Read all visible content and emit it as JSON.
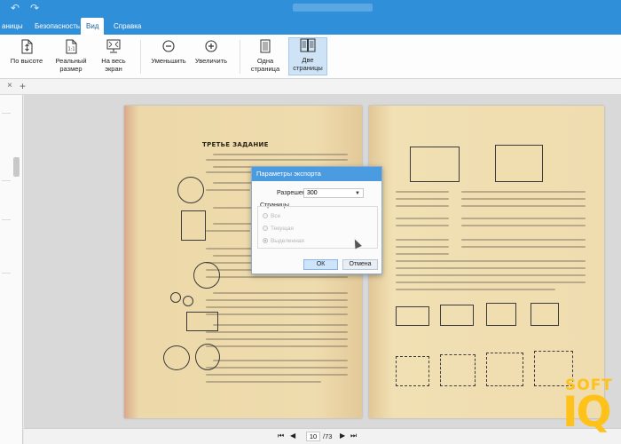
{
  "window": {
    "title": "",
    "undo_icon": "undo-icon",
    "redo_icon": "redo-icon"
  },
  "tabs": [
    {
      "label": "аницы"
    },
    {
      "label": "Безопасность"
    },
    {
      "label": "Вид"
    },
    {
      "label": "Справка"
    }
  ],
  "ribbon": {
    "fit_height": "По высоте",
    "actual_size_line1": "Реальный",
    "actual_size_line2": "размер",
    "fit_screen_line1": "На весь",
    "fit_screen_line2": "экран",
    "zoom_out": "Уменьшить",
    "zoom_in": "Увеличить",
    "one_page_line1": "Одна",
    "one_page_line2": "страница",
    "two_pages_line1": "Две",
    "two_pages_line2": "страницы"
  },
  "document": {
    "left_heading": "ТРЕТЬЕ ЗАДАНИЕ"
  },
  "dialog": {
    "title": "Параметры экспорта",
    "resolution_label": "Разрешение",
    "resolution_value": "300",
    "pages_label": "Страницы",
    "options": [
      {
        "label": "Все",
        "selected": false
      },
      {
        "label": "Текущая",
        "selected": false
      },
      {
        "label": "Выделенная",
        "selected": true
      }
    ],
    "ok": "ОК",
    "cancel": "Отмена"
  },
  "navigation": {
    "current_page": "10",
    "total_pages": "/73",
    "first_icon": "first-page-icon",
    "prev_icon": "prev-page-icon",
    "next_icon": "next-page-icon",
    "last_icon": "last-page-icon"
  },
  "watermark": {
    "line1": "SOFT",
    "line2": "IQ"
  },
  "colors": {
    "accent": "#2f8fd8",
    "dialog_title": "#4a9be0",
    "watermark": "#ffc21a"
  }
}
